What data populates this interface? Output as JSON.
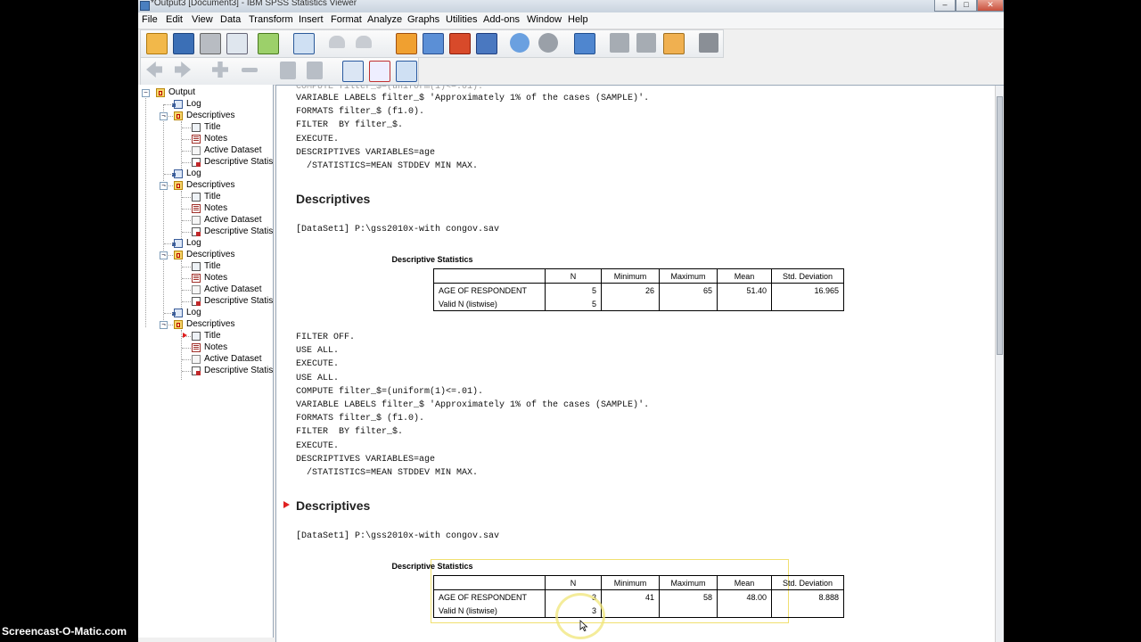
{
  "window": {
    "title": "*Output3 [Document3] - IBM SPSS Statistics Viewer",
    "minimize": "–",
    "maximize": "□",
    "close": "✕"
  },
  "menu": [
    "File",
    "Edit",
    "View",
    "Data",
    "Transform",
    "Insert",
    "Format",
    "Analyze",
    "Graphs",
    "Utilities",
    "Add-ons",
    "Window",
    "Help"
  ],
  "toolbar1": [
    "open-icon",
    "save-icon",
    "print-icon",
    "print-preview-icon",
    "export-icon",
    "recall-dialog-icon",
    "undo-icon",
    "redo-icon",
    "goto-case-icon",
    "goto-variable-icon",
    "insert-cases-icon",
    "variables-icon",
    "use-variable-sets-icon",
    "show-all-variables-icon",
    "split-file-icon",
    "select-cases-icon",
    "value-labels-icon",
    "weight-cases-icon",
    "spelling-icon",
    "run-script-icon"
  ],
  "toolbar2": [
    "back-icon",
    "forward-icon",
    "expand-icon",
    "collapse-icon",
    "show-icon",
    "hide-icon",
    "insert-heading-icon",
    "insert-title-icon",
    "insert-text-icon"
  ],
  "tree": {
    "root": "Output",
    "items": [
      {
        "label": "Log",
        "type": "log"
      },
      {
        "label": "Descriptives",
        "type": "desc"
      },
      {
        "label": "Title",
        "type": "title"
      },
      {
        "label": "Notes",
        "type": "notes"
      },
      {
        "label": "Active Dataset",
        "type": "ds"
      },
      {
        "label": "Descriptive Statist",
        "type": "stat"
      },
      {
        "label": "Log",
        "type": "log"
      },
      {
        "label": "Descriptives",
        "type": "desc"
      },
      {
        "label": "Title",
        "type": "title"
      },
      {
        "label": "Notes",
        "type": "notes"
      },
      {
        "label": "Active Dataset",
        "type": "ds"
      },
      {
        "label": "Descriptive Statist",
        "type": "stat"
      },
      {
        "label": "Log",
        "type": "log"
      },
      {
        "label": "Descriptives",
        "type": "desc"
      },
      {
        "label": "Title",
        "type": "title"
      },
      {
        "label": "Notes",
        "type": "notes"
      },
      {
        "label": "Active Dataset",
        "type": "ds"
      },
      {
        "label": "Descriptive Statist",
        "type": "stat"
      },
      {
        "label": "Log",
        "type": "log"
      },
      {
        "label": "Descriptives",
        "type": "desc"
      },
      {
        "label": "Title",
        "type": "title"
      },
      {
        "label": "Notes",
        "type": "notes"
      },
      {
        "label": "Active Dataset",
        "type": "ds"
      },
      {
        "label": "Descriptive Statist",
        "type": "stat"
      }
    ]
  },
  "output": {
    "log1": [
      "VARIABLE LABELS filter_$ 'Approximately 1% of the cases (SAMPLE)'.",
      "FORMATS filter_$ (f1.0).",
      "FILTER  BY filter_$.",
      "EXECUTE.",
      "DESCRIPTIVES VARIABLES=age",
      "  /STATISTICS=MEAN STDDEV MIN MAX."
    ],
    "heading1": "Descriptives",
    "dataset1": "[DataSet1] P:\\gss2010x-with congov.sav",
    "table1": {
      "title": "Descriptive Statistics",
      "headers": [
        "",
        "N",
        "Minimum",
        "Maximum",
        "Mean",
        "Std. Deviation"
      ],
      "rows": [
        [
          "AGE OF RESPONDENT",
          "5",
          "26",
          "65",
          "51.40",
          "16.965"
        ],
        [
          "Valid N (listwise)",
          "5",
          "",
          "",
          "",
          ""
        ]
      ]
    },
    "log2": [
      "FILTER OFF.",
      "USE ALL.",
      "EXECUTE.",
      "USE ALL.",
      "COMPUTE filter_$=(uniform(1)<=.01).",
      "VARIABLE LABELS filter_$ 'Approximately 1% of the cases (SAMPLE)'.",
      "FORMATS filter_$ (f1.0).",
      "FILTER  BY filter_$.",
      "EXECUTE.",
      "DESCRIPTIVES VARIABLES=age",
      "  /STATISTICS=MEAN STDDEV MIN MAX."
    ],
    "heading2": "Descriptives",
    "dataset2": "[DataSet1] P:\\gss2010x-with congov.sav",
    "table2": {
      "title": "Descriptive Statistics",
      "headers": [
        "",
        "N",
        "Minimum",
        "Maximum",
        "Mean",
        "Std. Deviation"
      ],
      "rows": [
        [
          "AGE OF RESPONDENT",
          "3",
          "41",
          "58",
          "48.00",
          "8.888"
        ],
        [
          "Valid N (listwise)",
          "3",
          "",
          "",
          "",
          ""
        ]
      ]
    }
  },
  "watermark": "Screencast-O-Matic.com",
  "colors": {
    "accent": "#e02020",
    "pane_border": "#9aa8b8"
  }
}
